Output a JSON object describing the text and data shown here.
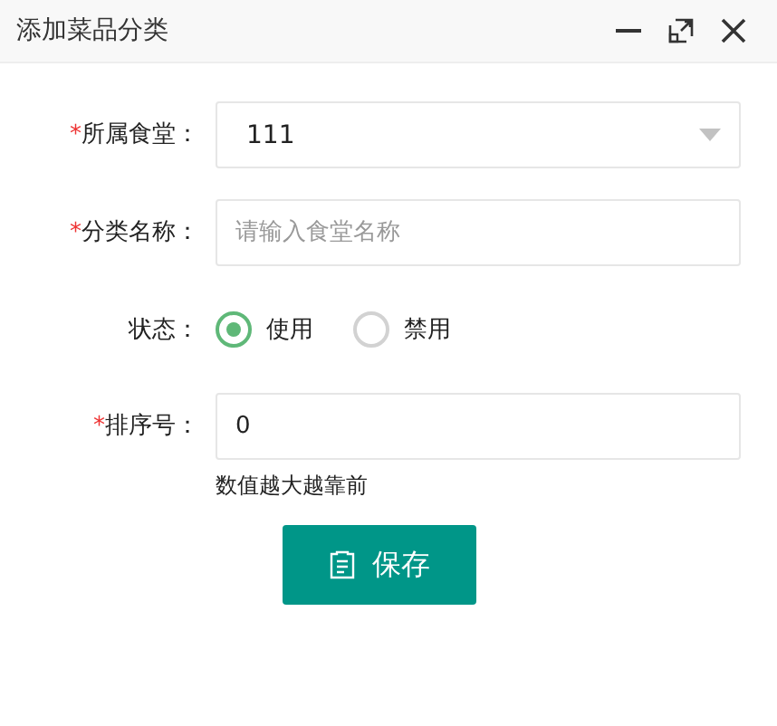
{
  "window": {
    "title": "添加菜品分类"
  },
  "fields": [
    {
      "kind": "select",
      "required_mark": "*",
      "label": "所属食堂：",
      "value": "111"
    },
    {
      "kind": "text",
      "required_mark": "*",
      "label": "分类名称：",
      "placeholder": "请输入食堂名称"
    },
    {
      "kind": "radio",
      "label": "状态：",
      "options": [
        {
          "label": "使用",
          "selected": true
        },
        {
          "label": "禁用",
          "selected": false
        }
      ]
    },
    {
      "kind": "text",
      "required_mark": "*",
      "label": "排序号：",
      "value": "0",
      "hint": "数值越大越靠前"
    }
  ],
  "save_button": {
    "label": "保存"
  }
}
